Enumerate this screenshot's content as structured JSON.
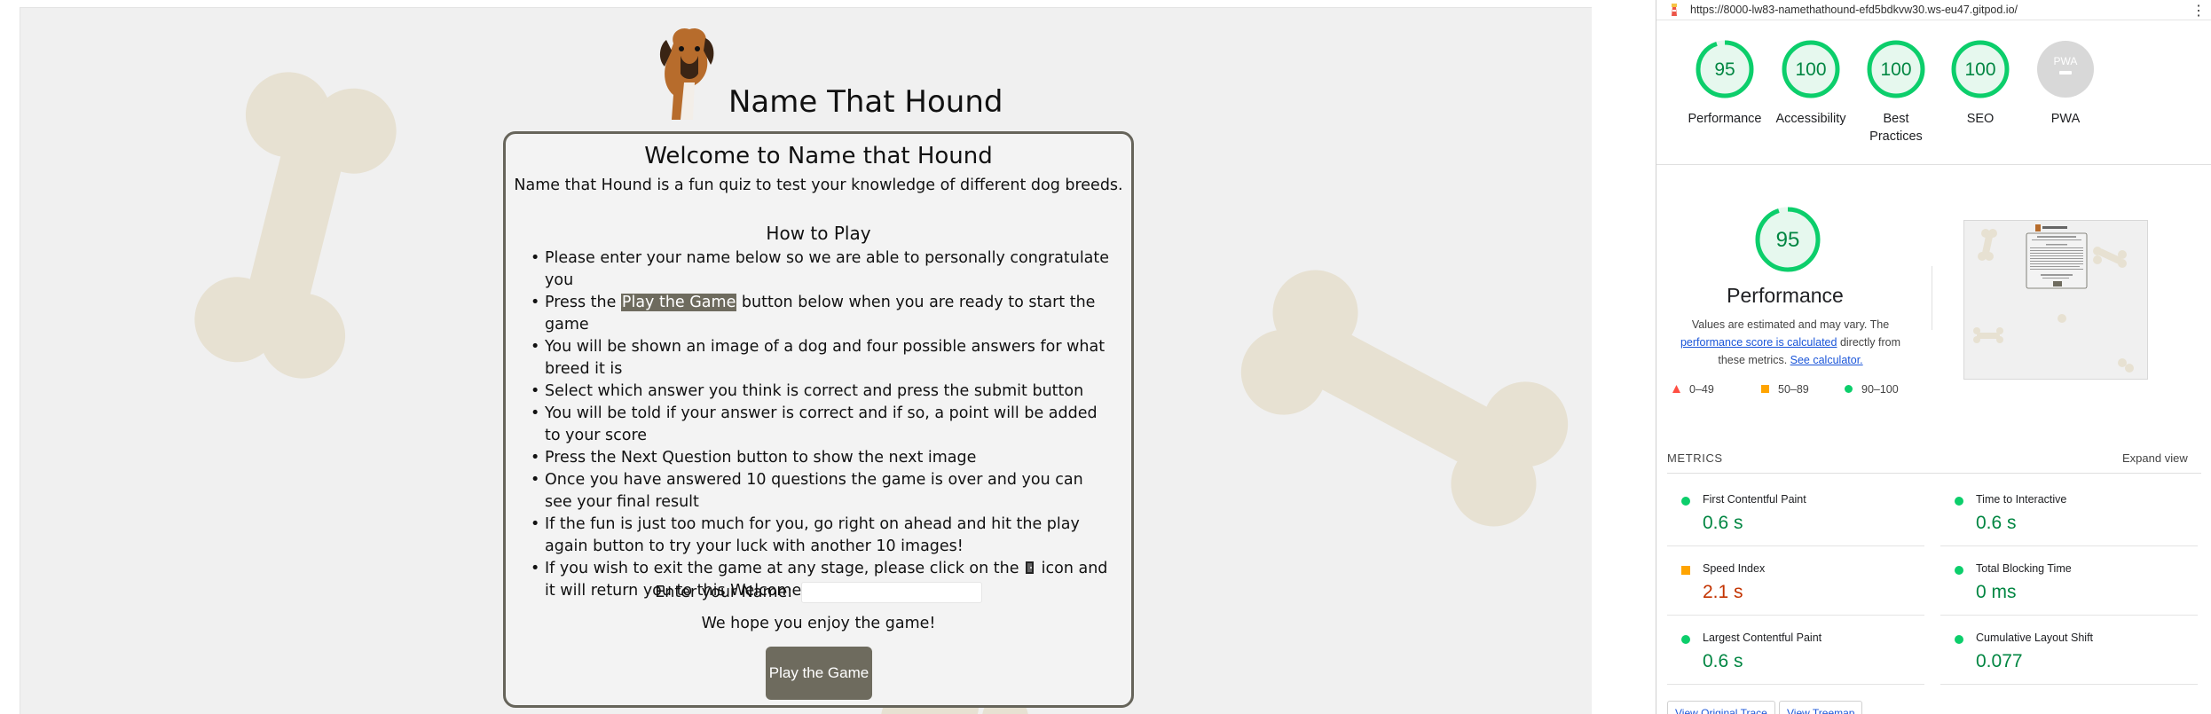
{
  "site": {
    "title": "Name That Hound",
    "card": {
      "heading": "Welcome to Name that Hound",
      "intro": "Name that Hound is a fun quiz to test your knowledge of different dog breeds.",
      "how_to_heading": "How to Play",
      "rules": {
        "r1": "Please enter your name below so we are able to personally congratulate you",
        "r2_pre": "Press the ",
        "r2_hl": "Play the Game",
        "r2_post": " button below when you are ready to start the game",
        "r3": "You will be shown an image of a dog and four possible answers for what breed it is",
        "r4": "Select which answer you think is correct and press the submit button",
        "r5": "You will be told if your answer is correct and if so, a point will be added to your score",
        "r6": "Press the Next Question button to show the next image",
        "r7": "Once you have answered 10 questions the game is over and you can see your final result",
        "r8": "If the fun is just too much for you, go right on ahead and hit the play again button to try your luck with another 10 images!",
        "r9_pre": "If you wish to exit the game at any stage, please click on the ",
        "r9_post": " icon and it will return you to this Welcome page"
      },
      "name_label": "Enter your Name:",
      "name_value": "",
      "enjoy": "We hope you enjoy the game!",
      "play_button": "Play the Game"
    }
  },
  "lighthouse": {
    "url": "https://8000-lw83-namethathound-efd5bdkvw30.ws-eu47.gitpod.io/",
    "gauges": [
      {
        "score": "95",
        "label": "Performance"
      },
      {
        "score": "100",
        "label": "Accessibility"
      },
      {
        "score": "100",
        "label": "Best Practices"
      },
      {
        "score": "100",
        "label": "SEO"
      },
      {
        "score": "",
        "label": "PWA",
        "badge": "PWA"
      }
    ],
    "performance": {
      "score": "95",
      "title": "Performance",
      "desc_1": "Values are estimated and may vary. The ",
      "desc_link": "performance score is calculated",
      "desc_2": " directly from these metrics. ",
      "desc_link2": "See calculator."
    },
    "legend": {
      "fail": "0–49",
      "average": "50–89",
      "pass": "90–100"
    },
    "metrics_heading": "METRICS",
    "expand_view": "Expand view",
    "metrics": [
      {
        "name": "First Contentful Paint",
        "value": "0.6 s",
        "status": "pass"
      },
      {
        "name": "Time to Interactive",
        "value": "0.6 s",
        "status": "pass"
      },
      {
        "name": "Speed Index",
        "value": "2.1 s",
        "status": "average"
      },
      {
        "name": "Total Blocking Time",
        "value": "0 ms",
        "status": "pass"
      },
      {
        "name": "Largest Contentful Paint",
        "value": "0.6 s",
        "status": "pass"
      },
      {
        "name": "Cumulative Layout Shift",
        "value": "0.077",
        "status": "pass"
      }
    ],
    "buttons": {
      "view_trace": "View Original Trace",
      "view_treemap": "View Treemap"
    },
    "colors": {
      "pass": "#0cce6b",
      "average": "#ffa400",
      "fail": "#ff4e42",
      "bone": "#e7e1d2",
      "button": "#6e6b5e"
    }
  }
}
